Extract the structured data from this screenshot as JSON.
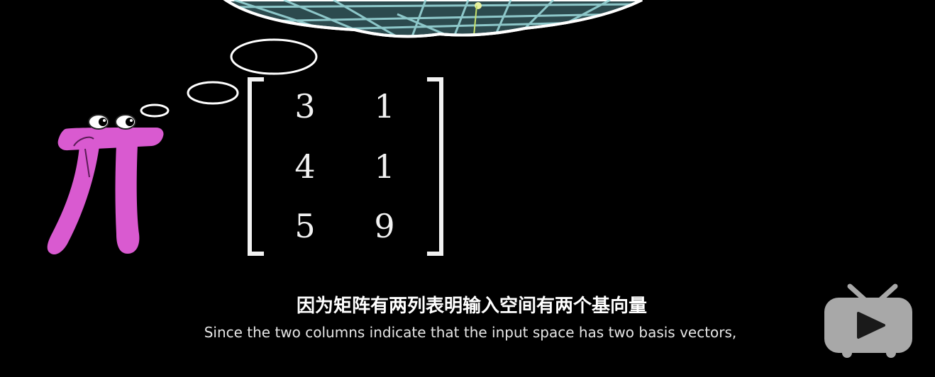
{
  "matrix": {
    "rows": [
      [
        "3",
        "1"
      ],
      [
        "4",
        "1"
      ],
      [
        "5",
        "9"
      ]
    ]
  },
  "subtitles": {
    "chinese": "因为矩阵有两列表明输入空间有两个基向量",
    "english": "Since the two columns indicate that the input space has two basis vectors,"
  },
  "icons": {
    "character": "pi-creature-icon",
    "thought_bubble": "thought-bubble-icon",
    "player_logo": "tv-play-icon"
  },
  "colors": {
    "background": "#000000",
    "pi_creature": "#d95ad0",
    "grid_lines": "#9fdde0",
    "bubble_fill": "#2c4a4e",
    "logo": "#a8a8a8"
  }
}
